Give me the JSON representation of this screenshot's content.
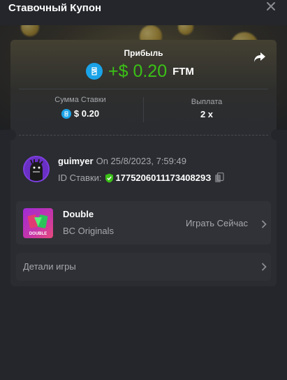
{
  "header": {
    "title": "Ставочный Купон",
    "close_icon": "close-icon"
  },
  "profit": {
    "label": "Прибыль",
    "amount": "+$ 0.20",
    "currency": "FTM",
    "amount_color": "#3bc117",
    "coin_icon": "fantom-coin-icon",
    "share_icon": "share-icon"
  },
  "stats": {
    "bet_amount_label": "Сумма Ставки",
    "bet_amount_value": "$ 0.20",
    "payout_label": "Выплата",
    "payout_value": "2 x"
  },
  "bet": {
    "username": "guimyer",
    "date": "On 25/8/2023, 7:59:49",
    "id_label": "ID Ставки:",
    "id_value": "177520601117340829З",
    "verified_icon": "shield-check-icon",
    "copy_icon": "copy-icon"
  },
  "game": {
    "name": "Double",
    "provider": "BC Originals",
    "thumb_label": "DOUBLE",
    "play_now": "Играть Сейчас"
  },
  "details": {
    "label": "Детали игры"
  }
}
